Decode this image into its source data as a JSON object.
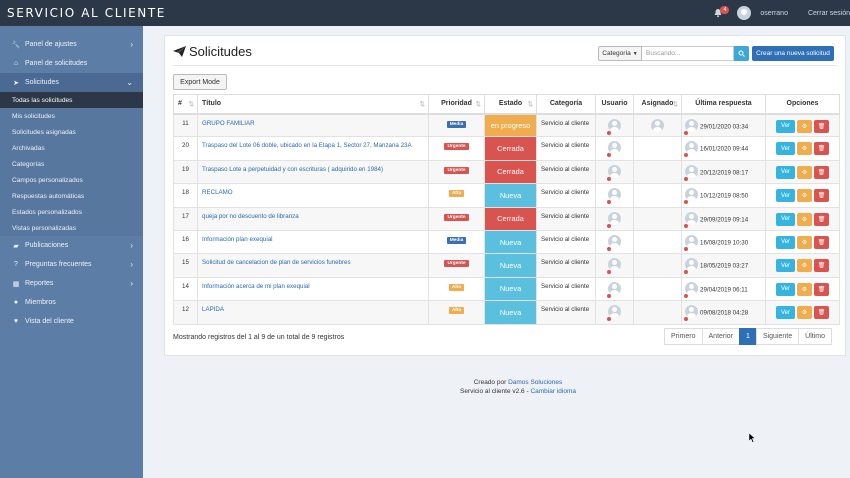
{
  "app": {
    "brand": "SERVICIO AL CLIENTE"
  },
  "topbar": {
    "notif_count": "4",
    "username": "oserrano",
    "logout": "Cerrar sesión"
  },
  "sidebar": {
    "items_top": [
      {
        "label": "Panel de ajustes",
        "icon": "wrench-icon",
        "chevron": true
      },
      {
        "label": "Panel de solicitudes",
        "icon": "home-icon",
        "chevron": false
      },
      {
        "label": "Solicitudes",
        "icon": "paper-plane-icon",
        "chevron": true
      }
    ],
    "sub_items": [
      "Todas las solicitudes",
      "Mis solicitudes",
      "Solicitudes asignadas",
      "Archivadas",
      "Categorías",
      "Campos personalizados",
      "Respuestas automáticas",
      "Estados personalizados",
      "Vistas personalizadas"
    ],
    "items_bottom": [
      {
        "label": "Publicaciones",
        "icon": "folder-icon",
        "chevron": true
      },
      {
        "label": "Preguntas frecuentes",
        "icon": "question-icon",
        "chevron": true
      },
      {
        "label": "Reportes",
        "icon": "chart-icon",
        "chevron": true
      },
      {
        "label": "Miembros",
        "icon": "users-icon",
        "chevron": false
      },
      {
        "label": "Vista del cliente",
        "icon": "heart-icon",
        "chevron": false
      }
    ]
  },
  "page": {
    "title": "Solicitudes",
    "category_filter": "Categoría",
    "search_placeholder": "Buscando...",
    "new_button": "Crear una nueva solicitud",
    "export_button": "Export Mode"
  },
  "table": {
    "headers": [
      "#",
      "Título",
      "Prioridad",
      "Estado",
      "Categoría",
      "Usuario",
      "Asignado",
      "Última respuesta",
      "Opciones"
    ],
    "rows": [
      {
        "id": "11",
        "title": "GRUPO FAMILIAR",
        "priority": "Media",
        "status": "en progreso",
        "category": "Servicio al cliente",
        "assigned": true,
        "last": "29/01/2020 03:34"
      },
      {
        "id": "20",
        "title": "Traspaso del Lote 06 doble, ubicado en la Etapa 1, Sector 27, Manzana 23A",
        "priority": "Urgente",
        "status": "Cerrada",
        "category": "Servicio al cliente",
        "assigned": false,
        "last": "16/01/2020 09:44"
      },
      {
        "id": "19",
        "title": "Traspaso Lote a perpetuidad y con escrituras ( adquirido en 1984)",
        "priority": "Urgente",
        "status": "Cerrada",
        "category": "Servicio al cliente",
        "assigned": false,
        "last": "20/12/2019 08:17"
      },
      {
        "id": "18",
        "title": "RECLAMO",
        "priority": "Alta",
        "status": "Nueva",
        "category": "Servicio al cliente",
        "assigned": false,
        "last": "10/12/2019 08:50"
      },
      {
        "id": "17",
        "title": "queja por no descuento de libranza",
        "priority": "Urgente",
        "status": "Cerrada",
        "category": "Servicio al cliente",
        "assigned": false,
        "last": "29/09/2019 09:14"
      },
      {
        "id": "16",
        "title": "Información plan exequial",
        "priority": "Media",
        "status": "Nueva",
        "category": "Servicio al cliente",
        "assigned": false,
        "last": "16/08/2019 10:30"
      },
      {
        "id": "15",
        "title": "Solicitud de cancelacion de plan de servicios funebres",
        "priority": "Urgente",
        "status": "Nueva",
        "category": "Servicio al cliente",
        "assigned": false,
        "last": "18/05/2019 03:27"
      },
      {
        "id": "14",
        "title": "Información acerca de mi plan exequial",
        "priority": "Alta",
        "status": "Nueva",
        "category": "Servicio al cliente",
        "assigned": false,
        "last": "29/04/2019 06:11"
      },
      {
        "id": "12",
        "title": "LAPIDA",
        "priority": "Alta",
        "status": "Nueva",
        "category": "Servicio al cliente",
        "assigned": false,
        "last": "09/08/2018 04:28"
      }
    ],
    "view_label": "Ver"
  },
  "pagination": {
    "summary": "Mostrando registros del 1 al 9 de un total de 9 registros",
    "first": "Primero",
    "prev": "Anterior",
    "current": "1",
    "next": "Siguiente",
    "last": "Último"
  },
  "footer": {
    "created_by": "Creado por",
    "company": "Damos Soluciones",
    "version": "Servicio al cliente v2.6 -",
    "change_language": "Cambiar idioma"
  },
  "colors": {
    "priority": {
      "Media": "#3a6fb0",
      "Urgente": "#d9534f",
      "Alta": "#f0ad4e"
    },
    "status": {
      "en progreso": "#f0ad4e",
      "Cerrada": "#d9534f",
      "Nueva": "#5bc0de"
    }
  }
}
